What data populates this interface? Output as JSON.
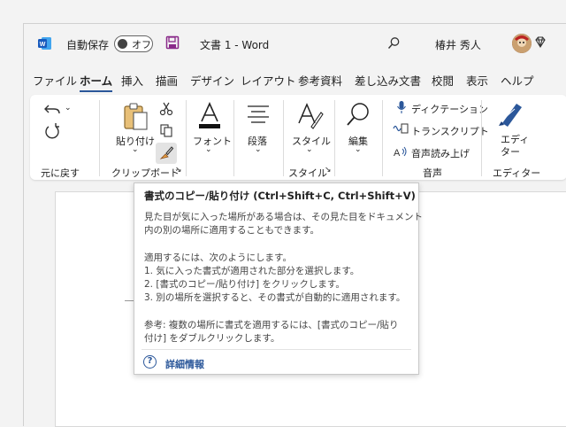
{
  "titlebar": {
    "autosave_label": "自動保存",
    "autosave_state": "オフ",
    "doc_title": "文書 1  -  Word",
    "user_name": "椿井 秀人"
  },
  "menu": [
    "ファイル",
    "ホーム",
    "挿入",
    "描画",
    "デザイン",
    "レイアウト",
    "参考資料",
    "差し込み文書",
    "校閲",
    "表示",
    "ヘルプ"
  ],
  "ribbon": {
    "undo_group": "元に戻す",
    "paste_label": "貼り付け",
    "clipboard_group": "クリップボード",
    "font_label": "フォント",
    "paragraph_label": "段落",
    "style_label": "スタイル",
    "style_group": "スタイル",
    "edit_label": "編集",
    "dictation_label": "ディクテーション",
    "transcribe_label": "トランスクリプト",
    "read_aloud_label": "音声読み上げ",
    "voice_group": "音声",
    "editor_label": "エディ\nター",
    "editor_group": "エディター"
  },
  "tooltip": {
    "title": "書式のコピー/貼り付け (Ctrl+Shift+C, Ctrl+Shift+V)",
    "desc1": "見た目が気に入った場所がある場合は、その見た目をドキュメント",
    "desc2": "内の別の場所に適用することもできます。",
    "how_title": "適用するには、次のようにします。",
    "step1": "1. 気に入った書式が適用された部分を選択します。",
    "step2": "2. [書式のコピー/貼り付け] をクリックします。",
    "step3": "3. 別の場所を選択すると、その書式が自動的に適用されます。",
    "note1": "参考: 複数の場所に書式を適用するには、[書式のコピー/貼り",
    "note2": "付け] をダブルクリックします。",
    "link": "詳細情報"
  },
  "colors": {
    "accent": "#2b579a",
    "save_icon": "#8a2a8a"
  }
}
